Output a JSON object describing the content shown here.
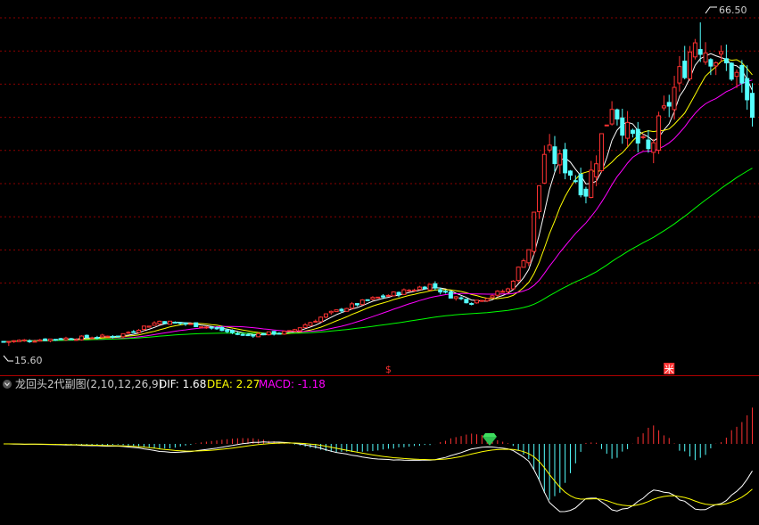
{
  "chart_data": [
    {
      "type": "candlestick",
      "price_high_label": "66.50",
      "price_low_label": "15.60",
      "price_high": 66.5,
      "price_low": 15.6,
      "ylim": [
        14.5,
        67.5
      ],
      "signal_markers": [
        {
          "index": 74,
          "text": "$",
          "color": "#ff3232"
        },
        {
          "index": 128,
          "text": "米",
          "color": "#ffffff",
          "bg": "#ff3232"
        }
      ],
      "series": [
        {
          "name": "MA-white",
          "color": "#ffffff"
        },
        {
          "name": "MA-yellow",
          "color": "#ffff00"
        },
        {
          "name": "MA-magenta",
          "color": "#ff00ff"
        },
        {
          "name": "MA-green",
          "color": "#00ff00"
        }
      ],
      "colors": {
        "up": "#ff3232",
        "down": "#54ffff",
        "grid": "#8b0000"
      }
    },
    {
      "type": "macd",
      "title": "龙回头2代副图(2,10,12,26,9)",
      "dif_label": "DIF: 1.68",
      "dea_label": "DEA: 2.27",
      "macd_label": "MACD: -1.18",
      "dif": 1.68,
      "dea": 2.27,
      "macd": -1.18,
      "colors": {
        "dif": "#ffffff",
        "dea": "#ffff00",
        "macd_text": "#ff00ff",
        "pos_bar": "#ff3232",
        "neg_bar": "#54ffff",
        "marker": "#3fdf5f"
      }
    }
  ]
}
